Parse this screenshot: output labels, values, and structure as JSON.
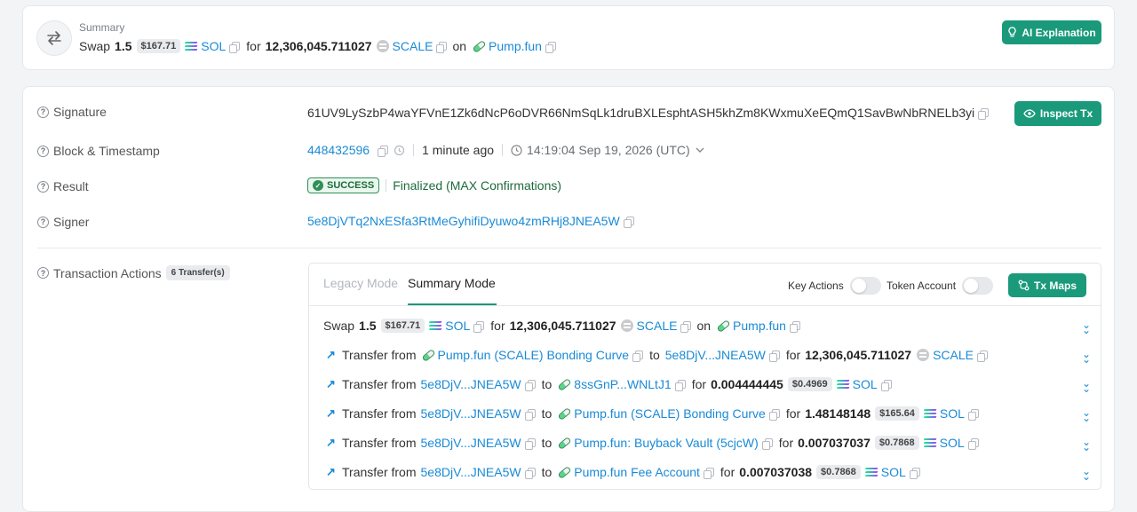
{
  "summary": {
    "label": "Summary",
    "swap_word": "Swap",
    "amount": "1.5",
    "usd": "$167.71",
    "from_token": "SOL",
    "for_word": "for",
    "to_amount": "12,306,045.711027",
    "to_token": "SCALE",
    "on_word": "on",
    "platform": "Pump.fun",
    "ai_button": "AI Explanation"
  },
  "details": {
    "signature_label": "Signature",
    "signature": "61UV9LySzbP4waYFVnE1Zk6dNcP6oDVR66NmSqLk1druBXLEsphtASH5khZm8KWxmuXeEQmQ1SavBwNbRNELb3yi",
    "inspect_button": "Inspect Tx",
    "block_label": "Block & Timestamp",
    "block": "448432596",
    "relative_time": "1 minute ago",
    "timestamp": "14:19:04 Sep 19, 2026 (UTC)",
    "result_label": "Result",
    "result_badge": "SUCCESS",
    "result_text": "Finalized (MAX Confirmations)",
    "signer_label": "Signer",
    "signer": "5e8DjVTq2NxESfa3RtMeGyhifiDyuwo4zmRHj8JNEA5W",
    "actions_label": "Transaction Actions",
    "actions_badge": "6 Transfer(s)"
  },
  "actions": {
    "tab_legacy": "Legacy Mode",
    "tab_summary": "Summary Mode",
    "key_actions": "Key Actions",
    "token_account": "Token Account",
    "tx_maps": "Tx Maps",
    "swap": {
      "swap_word": "Swap",
      "amount": "1.5",
      "usd": "$167.71",
      "from_token": "SOL",
      "for_word": "for",
      "to_amount": "12,306,045.711027",
      "to_token": "SCALE",
      "on_word": "on",
      "platform": "Pump.fun"
    },
    "transfer_word": "Transfer from",
    "to_word": "to",
    "for_word": "for",
    "transfers": [
      {
        "from": "Pump.fun (SCALE) Bonding Curve",
        "to": "5e8DjV...JNEA5W",
        "amount": "12,306,045.711027",
        "usd": "",
        "token": "SCALE"
      },
      {
        "from": "5e8DjV...JNEA5W",
        "to": "8ssGnP...WNLtJ1",
        "amount": "0.004444445",
        "usd": "$0.4969",
        "token": "SOL"
      },
      {
        "from": "5e8DjV...JNEA5W",
        "to": "Pump.fun (SCALE) Bonding Curve",
        "amount": "1.48148148",
        "usd": "$165.64",
        "token": "SOL"
      },
      {
        "from": "5e8DjV...JNEA5W",
        "to": "Pump.fun: Buyback Vault (5cjcW)",
        "amount": "0.007037037",
        "usd": "$0.7868",
        "token": "SOL"
      },
      {
        "from": "5e8DjV...JNEA5W",
        "to": "Pump.fun Fee Account",
        "amount": "0.007037038",
        "usd": "$0.7868",
        "token": "SOL"
      }
    ]
  },
  "colors": {
    "accent": "#1a9a7a",
    "link": "#1a8ad6",
    "success": "#2f8f55"
  }
}
